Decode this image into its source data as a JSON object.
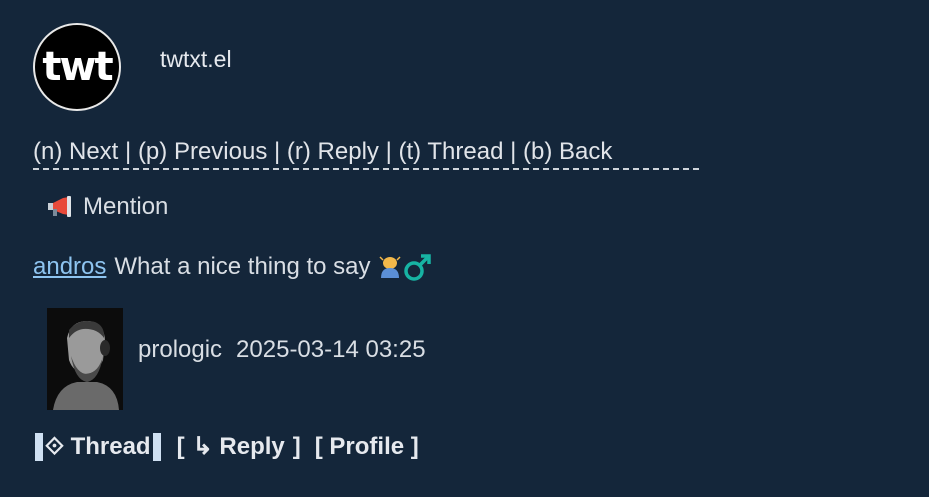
{
  "app": {
    "logo_text": "twt",
    "title": "twtxt.el"
  },
  "nav": {
    "next": "(n) Next",
    "previous": "(p) Previous",
    "reply": "(r) Reply",
    "thread": "(t) Thread",
    "back": "(b) Back",
    "separator": " | "
  },
  "notification": {
    "icon": "megaphone-icon",
    "label": "Mention"
  },
  "message": {
    "mention_user": "andros",
    "text": "What a nice thing to say",
    "emoji_icons": [
      "person-bowing-icon",
      "male-sign-icon"
    ]
  },
  "post": {
    "author": "prologic",
    "timestamp": "2025-03-14 03:25"
  },
  "actions": {
    "thread": "⟐ Thread",
    "reply_open": "[",
    "reply": "↳ Reply",
    "reply_close": "]",
    "profile": "[ Profile ]"
  },
  "colors": {
    "background": "#14263a",
    "text": "#d9dee4",
    "link": "#8ec4f0"
  }
}
